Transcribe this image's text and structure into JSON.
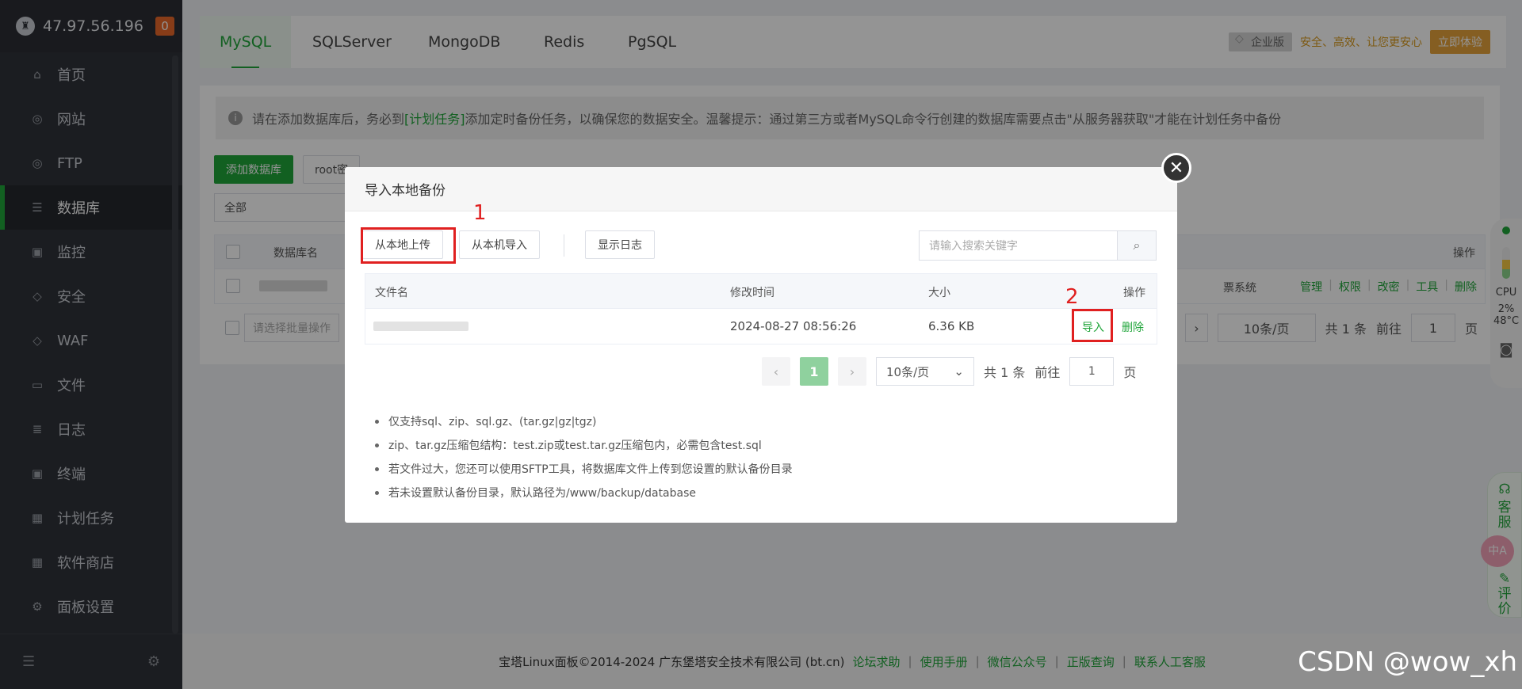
{
  "sidebar": {
    "ip": "47.97.56.196",
    "badge": "0",
    "items": [
      {
        "label": "首页",
        "icon": "home-icon",
        "glyph": "⌂"
      },
      {
        "label": "网站",
        "icon": "globe-icon",
        "glyph": "◎"
      },
      {
        "label": "FTP",
        "icon": "ftp-icon",
        "glyph": "◎"
      },
      {
        "label": "数据库",
        "icon": "database-icon",
        "glyph": "☰"
      },
      {
        "label": "监控",
        "icon": "monitor-icon",
        "glyph": "▣"
      },
      {
        "label": "安全",
        "icon": "shield-icon",
        "glyph": "◇"
      },
      {
        "label": "WAF",
        "icon": "waf-icon",
        "glyph": "◇"
      },
      {
        "label": "文件",
        "icon": "folder-icon",
        "glyph": "▭"
      },
      {
        "label": "日志",
        "icon": "log-icon",
        "glyph": "≣"
      },
      {
        "label": "终端",
        "icon": "terminal-icon",
        "glyph": "▣"
      },
      {
        "label": "计划任务",
        "icon": "calendar-icon",
        "glyph": "▦"
      },
      {
        "label": "软件商店",
        "icon": "apps-icon",
        "glyph": "▦"
      },
      {
        "label": "面板设置",
        "icon": "gear-icon",
        "glyph": "⚙"
      }
    ]
  },
  "tabs": [
    "MySQL",
    "SQLServer",
    "MongoDB",
    "Redis",
    "PgSQL"
  ],
  "promo": {
    "edition": "企业版",
    "slogan": "安全、高效、让您更安心",
    "try": "立即体验"
  },
  "notice": {
    "pre": "请在添加数据库后，务必到",
    "link": "[计划任务]",
    "post": "添加定时备份任务，以确保您的数据安全。温馨提示：通过第三方或者MySQL命令行创建的数据库需要点击\"从服务器获取\"才能在计划任务中备份"
  },
  "background": {
    "add_button": "添加数据库",
    "root_button": "root密",
    "filter": "全部",
    "col_name": "数据库名",
    "col_ops": "操作",
    "row_sys": "票系统",
    "row_actions": [
      "管理",
      "权限",
      "改密",
      "工具",
      "删除"
    ],
    "batch_placeholder": "请选择批量操作",
    "page_size": "10条/页",
    "total": "共 1 条",
    "goto": "前往",
    "page_input": "1",
    "page_unit": "页"
  },
  "modal": {
    "title": "导入本地备份",
    "btn_upload": "从本地上传",
    "btn_import_local": "从本机导入",
    "btn_log": "显示日志",
    "search_placeholder": "请输入搜索关键字",
    "col_file": "文件名",
    "col_time": "修改时间",
    "col_size": "大小",
    "col_ops": "操作",
    "row": {
      "time": "2024-08-27 08:56:26",
      "size": "6.36 KB",
      "import": "导入",
      "delete": "删除"
    },
    "pager": {
      "current": "1",
      "page_size": "10条/页",
      "total": "共 1 条",
      "goto": "前往",
      "page_input": "1",
      "page_unit": "页"
    },
    "notes": [
      "仅支持sql、zip、sql.gz、(tar.gz|gz|tgz)",
      "zip、tar.gz压缩包结构：test.zip或test.tar.gz压缩包内，必需包含test.sql",
      "若文件过大，您还可以使用SFTP工具，将数据库文件上传到您设置的默认备份目录",
      "若未设置默认备份目录，默认路径为/www/backup/database"
    ]
  },
  "annotations": {
    "one": "1",
    "two": "2"
  },
  "footer": {
    "copyright": "宝塔Linux面板©2014-2024 广东堡塔安全技术有限公司 (bt.cn)",
    "links": [
      "论坛求助",
      "使用手册",
      "微信公众号",
      "正版查询",
      "联系人工客服"
    ]
  },
  "monitor": {
    "cpu_label": "CPU",
    "cpu_value": "2%",
    "temp": "48°C"
  },
  "service": {
    "chars_top": [
      "客",
      "服"
    ],
    "chars_bottom": [
      "评",
      "价"
    ],
    "translate": "中A"
  },
  "watermark": "CSDN @wow_xh",
  "colors": {
    "accent": "#20a53a",
    "sidebar": "#30333a",
    "annotation": "#e02020",
    "promo": "#e6a23c"
  }
}
